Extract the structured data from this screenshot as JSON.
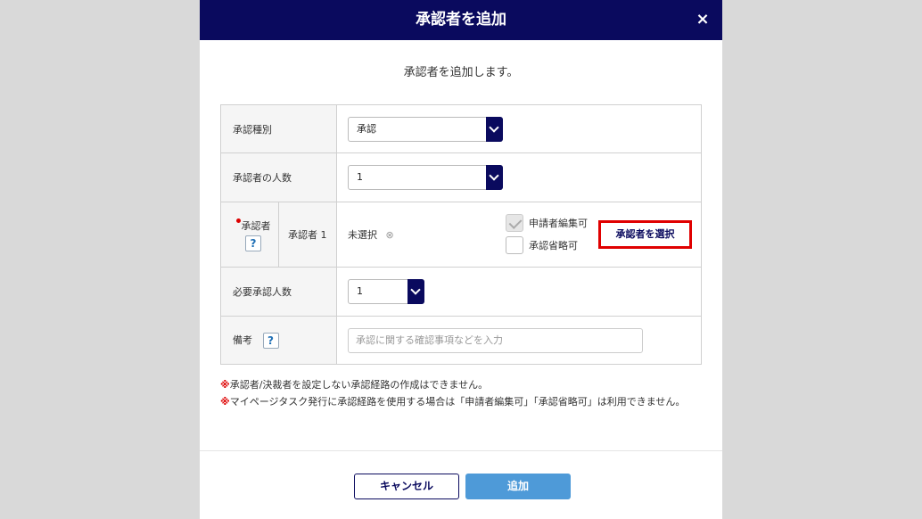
{
  "dialog": {
    "title": "承認者を追加",
    "close_label": "×",
    "intro": "承認者を追加します。"
  },
  "form": {
    "type": {
      "label": "承認種別",
      "value": "承認"
    },
    "count": {
      "label": "承認者の人数",
      "value": "1"
    },
    "approver": {
      "label": "承認者",
      "help": "?",
      "sub_label": "承認者 1",
      "status": "未選択",
      "clear_icon": "⊗",
      "editable_label": "申請者編集可",
      "omittable_label": "承認省略可",
      "select_button": "承認者を選択"
    },
    "required": {
      "label": "必要承認人数",
      "value": "1"
    },
    "remarks": {
      "label": "備考",
      "help": "?",
      "placeholder": "承認に関する確認事項などを入力"
    }
  },
  "notes": [
    {
      "mark": "※",
      "text": "承認者/決裁者を設定しない承認経路の作成はできません。"
    },
    {
      "mark": "※",
      "text": "マイページタスク発行に承認経路を使用する場合は「申請者編集可」「承認省略可」は利用できません。"
    }
  ],
  "buttons": {
    "cancel": "キャンセル",
    "add": "追加"
  },
  "colors": {
    "header_bg": "#0a0a5e",
    "primary": "#4e9ad8",
    "highlight": "#e00000",
    "required_dot": "#d00000"
  }
}
